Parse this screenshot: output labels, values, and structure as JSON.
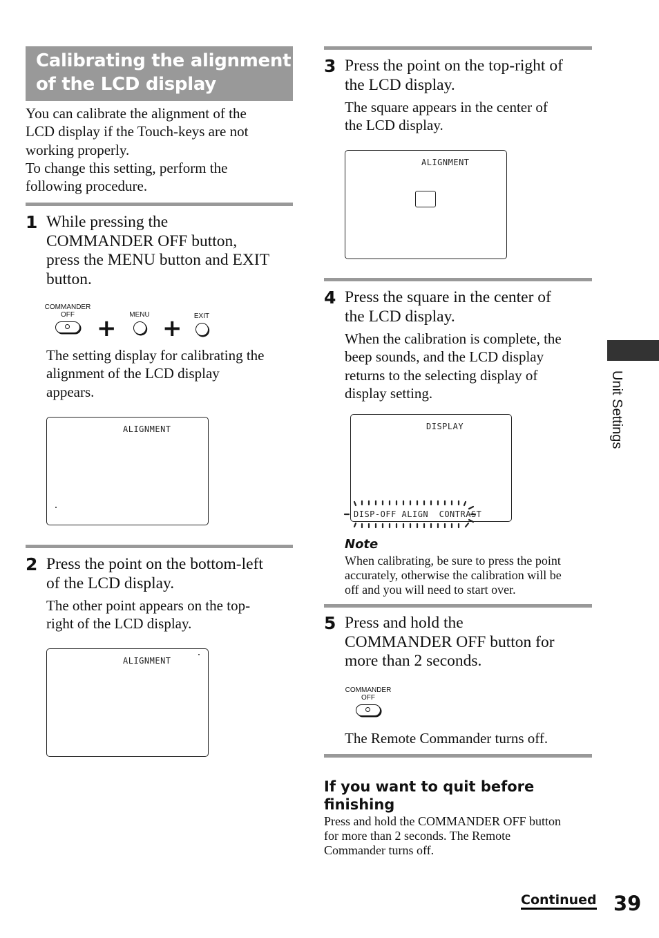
{
  "section_title": [
    "Calibrating the alignment",
    "of the LCD display"
  ],
  "intro": [
    "You can calibrate the alignment of the",
    "LCD display if the Touch-keys are not",
    "working properly.",
    "To change this setting, perform the",
    "following procedure."
  ],
  "steps": [
    {
      "number": "1",
      "instruction": [
        "While pressing the",
        "COMMANDER OFF button,",
        "press the MENU button and EXIT",
        "button."
      ],
      "buttons": {
        "commander_off": [
          "COMMANDER",
          "OFF"
        ],
        "menu": "MENU",
        "exit": "EXIT",
        "plus": "+"
      },
      "result": [
        "The setting display for calibrating the",
        "alignment of the LCD display",
        "appears."
      ],
      "lcd": {
        "label": "ALIGNMENT",
        "marker": "point at bottom-left"
      }
    },
    {
      "number": "2",
      "instruction": [
        "Press the point on the bottom-left",
        "of the LCD display."
      ],
      "result": [
        "The other point appears on the top-",
        "right of the LCD display."
      ],
      "lcd": {
        "label": "ALIGNMENT",
        "marker": "point at top-right"
      }
    },
    {
      "number": "3",
      "instruction": [
        "Press the point on the top-right of",
        "the LCD display."
      ],
      "result": [
        "The square appears in the center of",
        "the LCD display."
      ],
      "lcd": {
        "label": "ALIGNMENT",
        "marker": "square in center"
      }
    },
    {
      "number": "4",
      "instruction": [
        "Press the square in the center of",
        "the LCD display."
      ],
      "result": [
        "When the calibration is complete, the",
        "beep sounds, and the LCD display",
        "returns to the selecting display of",
        "display setting."
      ],
      "lcd": {
        "label": "DISPLAY",
        "menu": "DISP-OFF ALIGN  CONTRAST",
        "menu_state": "blinking"
      }
    },
    {
      "number": "5",
      "instruction": [
        "Press and hold the",
        "COMMANDER OFF button for",
        "more than 2 seconds."
      ],
      "buttons": {
        "commander_off": [
          "COMMANDER",
          "OFF"
        ]
      },
      "result": [
        "The Remote Commander turns off."
      ]
    }
  ],
  "note": {
    "heading": "Note",
    "lines": [
      "When calibrating, be sure to press the point",
      "accurately, otherwise the calibration will be",
      "off and you will need to start over."
    ]
  },
  "quit_section": {
    "heading": [
      "If you want to quit before",
      "finishing"
    ],
    "lines": [
      "Press and hold the COMMANDER OFF button",
      "for more than 2 seconds. The Remote",
      "Commander turns off."
    ]
  },
  "side_tab": "Unit Settings",
  "footer": {
    "continued": "Continued",
    "page_number": "39"
  }
}
